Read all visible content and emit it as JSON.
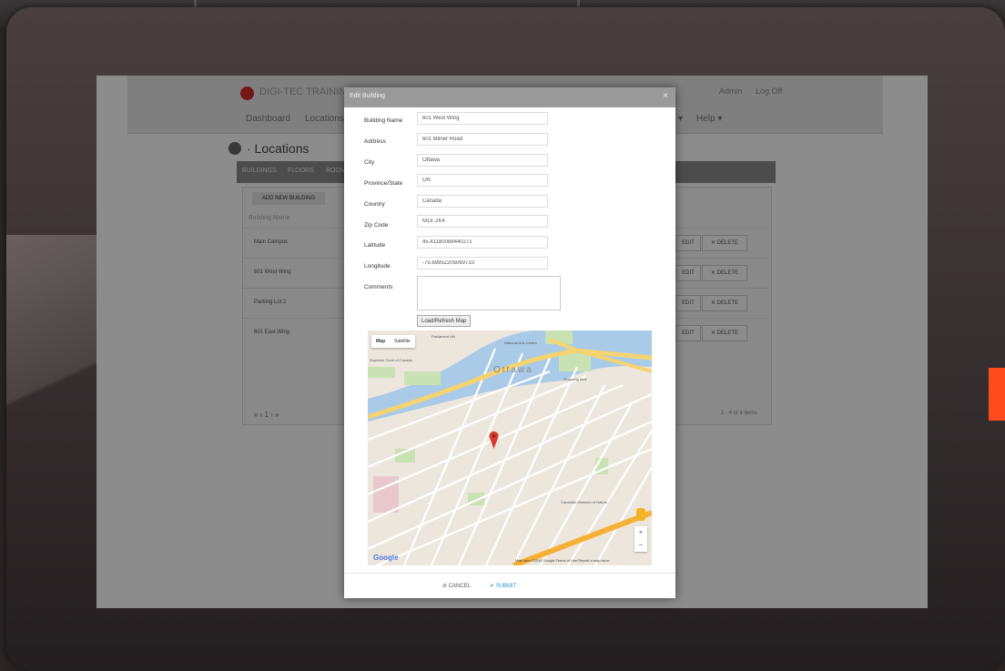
{
  "app": {
    "brand": "DIGI-TEC TRAINING",
    "nav": [
      "Dashboard",
      "Locations"
    ],
    "nav_right_1": "Admin",
    "nav_right_2": "Log Off",
    "nav_help": "Help ▾",
    "nav_dropdown": "▾",
    "page_title": "· Locations",
    "tabs": [
      "BUILDINGS",
      "FLOORS",
      "ROOMS"
    ],
    "add_button": "ADD NEW BUILDING",
    "column_header": "Building Name",
    "rows": [
      {
        "name": "Main Campus"
      },
      {
        "name": "601 West Wing"
      },
      {
        "name": "Parking Lot 2"
      },
      {
        "name": "601 East Wing"
      }
    ],
    "edit_label": "EDIT",
    "delete_label": "✕ DELETE",
    "pager": "«  ‹  1  ›  »",
    "item_count": "1 - 4 of 4 items"
  },
  "modal": {
    "title": "Edit Building",
    "close": "×",
    "fields": [
      {
        "label": "Building Name",
        "value": "601 West Wing"
      },
      {
        "label": "Address",
        "value": "601 Milner Road"
      },
      {
        "label": "City",
        "value": "Ottawa"
      },
      {
        "label": "Province/State",
        "value": "ON"
      },
      {
        "label": "Country",
        "value": "Canada"
      },
      {
        "label": "Zip Code",
        "value": "M1E 2K4"
      },
      {
        "label": "Latitude",
        "value": "45.41180088440271"
      },
      {
        "label": "Longitude",
        "value": "-75.69952205069733"
      }
    ],
    "comments_label": "Comments",
    "load_map_button": "Load/Refresh Map",
    "cancel": "⊘ CANCEL",
    "submit": "✔ SUBMIT"
  },
  "map": {
    "type_map": "Map",
    "type_satellite": "Satellite",
    "city_label": "Ottawa",
    "labels": [
      "Parliament Hill",
      "National Arts Centre",
      "Supreme Court of Canada",
      "Shopping Mall",
      "Canadian Museum of Nature"
    ],
    "google": "Google",
    "footer": "Map data ©2016 Google   Terms of Use   Report a map error",
    "zoom_in": "+",
    "zoom_out": "−"
  },
  "colors": {
    "accent": "#ff4b1e",
    "marker": "#d63b2f",
    "submit": "#2f8fd0"
  }
}
